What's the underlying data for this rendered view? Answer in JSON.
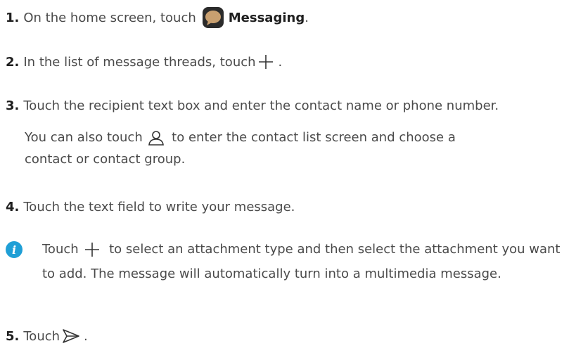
{
  "steps": [
    {
      "num": "1.",
      "before": "On the home screen, touch ",
      "bold": "Messaging",
      "after": "."
    },
    {
      "num": "2.",
      "before": "In the list of message threads, touch ",
      "after": "."
    },
    {
      "num": "3.",
      "text": "Touch the recipient text box and enter the contact name or phone number."
    },
    {
      "num": "4.",
      "text": "Touch the text field to write your message."
    },
    {
      "num": "5.",
      "before": "Touch ",
      "after": "."
    }
  ],
  "step3_sub": {
    "before": "You can also touch ",
    "after": " to enter the contact list screen and choose a contact or contact group."
  },
  "note": {
    "before": "Touch ",
    "after": " to select an attachment type and then select the attachment you want to add. The message will automatically turn into a multimedia message."
  },
  "icons": {
    "messaging": "messaging-app-icon",
    "plus": "plus-icon",
    "contact": "person-icon",
    "info": "info-icon",
    "send": "send-icon"
  },
  "colors": {
    "info_blue": "#1f9fd6",
    "text": "#4a4a4a",
    "heading": "#1f1f1f"
  }
}
